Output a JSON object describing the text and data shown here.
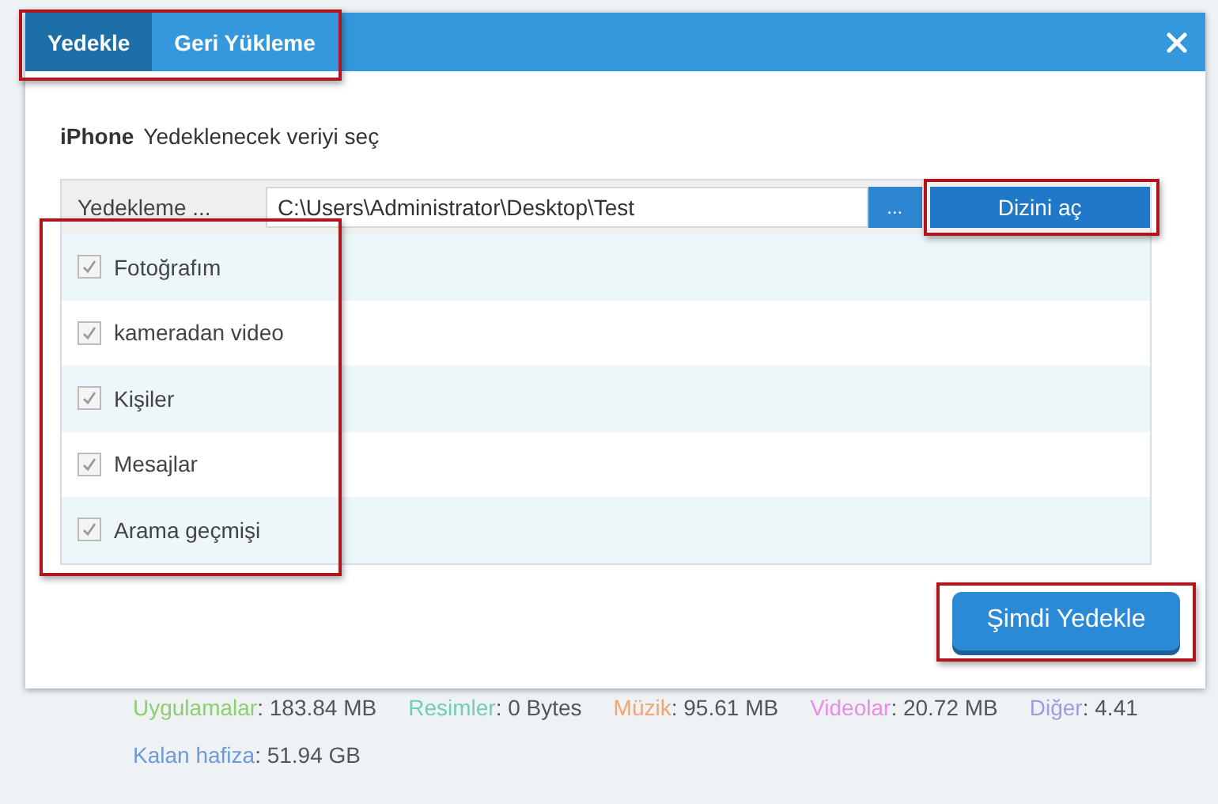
{
  "dialog": {
    "tabs": [
      {
        "label": "Yedekle",
        "selected": true
      },
      {
        "label": "Geri Yükleme",
        "selected": false
      }
    ],
    "device": "iPhone",
    "instruction": "Yedeklenecek veriyi seç",
    "path_row": {
      "label": "Yedekleme ...",
      "value": "C:\\Users\\Administrator\\Desktop\\Test",
      "browse": "...",
      "open_button": "Dizini aç"
    },
    "items": [
      {
        "label": "Fotoğrafım",
        "checked": true
      },
      {
        "label": "kameradan video",
        "checked": true
      },
      {
        "label": "Kişiler",
        "checked": true
      },
      {
        "label": "Mesajlar",
        "checked": true
      },
      {
        "label": "Arama geçmişi",
        "checked": true
      }
    ],
    "primary_button": "Şimdi Yedekle"
  },
  "storage": [
    {
      "label": "Uygulamalar",
      "value": ": 183.84 MB",
      "color": "#8ccf6c"
    },
    {
      "label": "Resimler",
      "value": ": 0 Bytes",
      "color": "#6fcfae"
    },
    {
      "label": "Müzik",
      "value": ": 95.61 MB",
      "color": "#f2a472"
    },
    {
      "label": "Videolar",
      "value": ": 20.72 MB",
      "color": "#e98ce4"
    },
    {
      "label": "Diğer",
      "value": ": 4.41",
      "color": "#9c9ce2"
    },
    {
      "label": "Kalan hafiza",
      "value": ": 51.94 GB",
      "color": "#6e9ad8"
    }
  ]
}
